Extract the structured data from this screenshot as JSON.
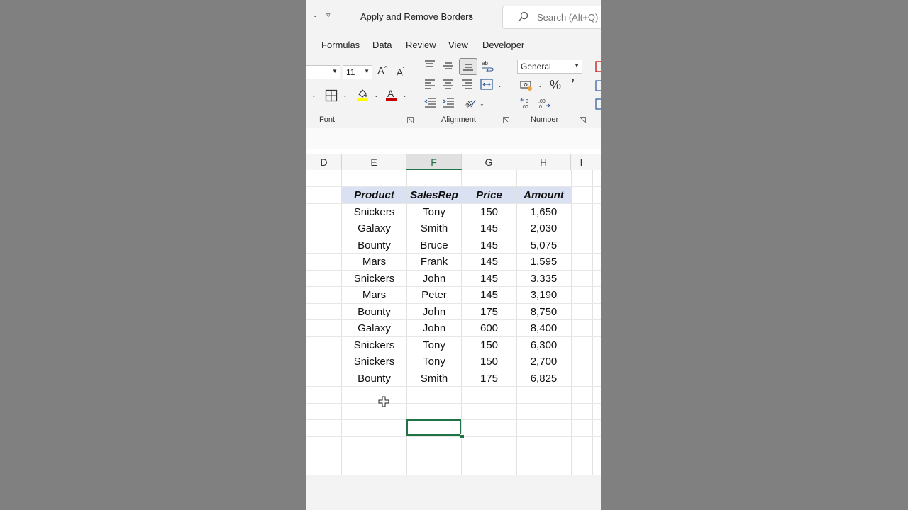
{
  "title_bar": {
    "document_title": "Apply and Remove Borders",
    "search_placeholder": "Search (Alt+Q)"
  },
  "tabs": [
    {
      "label": "Formulas"
    },
    {
      "label": "Data"
    },
    {
      "label": "Review"
    },
    {
      "label": "View"
    },
    {
      "label": "Developer"
    }
  ],
  "ribbon": {
    "font_size": "11",
    "number_format": "General",
    "groups": {
      "font": "Font",
      "alignment": "Alignment",
      "number": "Number"
    },
    "colors": {
      "highlight": "#ffff00",
      "font_color": "#c00000"
    }
  },
  "grid": {
    "columns": [
      "D",
      "E",
      "F",
      "G",
      "H",
      "I"
    ],
    "selected_column": "F",
    "table_headers": [
      "Product",
      "SalesRep",
      "Price",
      "Amount"
    ],
    "rows": [
      [
        "Snickers",
        "Tony",
        "150",
        "1,650"
      ],
      [
        "Galaxy",
        "Smith",
        "145",
        "2,030"
      ],
      [
        "Bounty",
        "Bruce",
        "145",
        "5,075"
      ],
      [
        "Mars",
        "Frank",
        "145",
        "1,595"
      ],
      [
        "Snickers",
        "John",
        "145",
        "3,335"
      ],
      [
        "Mars",
        "Peter",
        "145",
        "3,190"
      ],
      [
        "Bounty",
        "John",
        "175",
        "8,750"
      ],
      [
        "Galaxy",
        "John",
        "600",
        "8,400"
      ],
      [
        "Snickers",
        "Tony",
        "150",
        "6,300"
      ],
      [
        "Snickers",
        "Tony",
        "150",
        "2,700"
      ],
      [
        "Bounty",
        "Smith",
        "175",
        "6,825"
      ]
    ],
    "header_fill_color": "#d9e1f2",
    "accent_color": "#217346"
  }
}
